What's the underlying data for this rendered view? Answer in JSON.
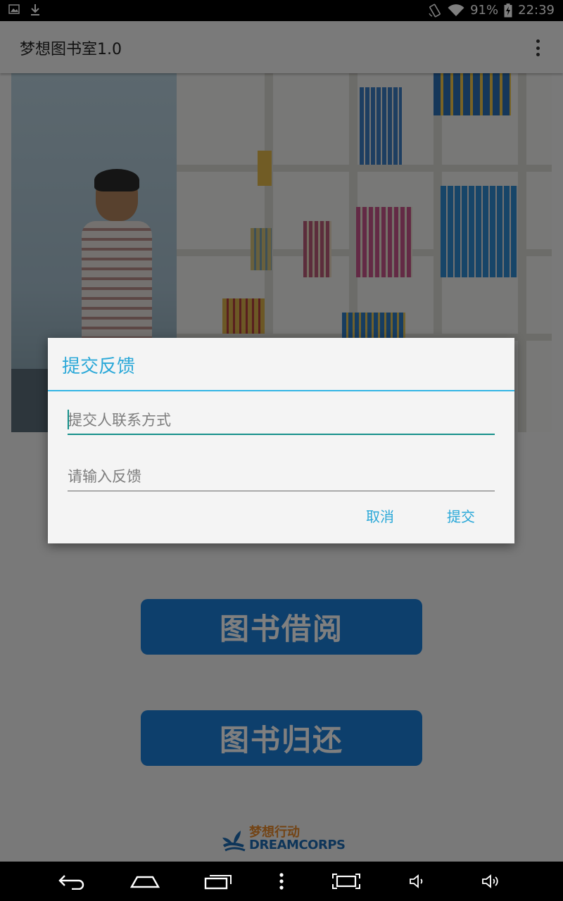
{
  "status_bar": {
    "battery": "91%",
    "time": "22:39",
    "icons": [
      "image-icon",
      "download-icon",
      "rotate-icon",
      "wifi-icon",
      "battery-charging-icon"
    ]
  },
  "action_bar": {
    "title": "梦想图书室1.0",
    "overflow_icon": "more-vert-icon"
  },
  "main": {
    "borrow_label": "图书借阅",
    "return_label": "图书归还",
    "logo_cn": "梦想行动",
    "logo_en": "DREAMCORPS",
    "button_color": "#1b7fd9"
  },
  "dialog": {
    "title": "提交反馈",
    "contact_placeholder": "提交人联系方式",
    "contact_value": "",
    "feedback_placeholder": "请输入反馈",
    "feedback_value": "",
    "cancel_label": "取消",
    "submit_label": "提交",
    "accent_color": "#33b5e5"
  },
  "nav_bar": {
    "icons": [
      "back-icon",
      "home-icon",
      "recent-apps-icon",
      "menu-dots-icon",
      "screenshot-icon",
      "volume-down-icon",
      "volume-up-icon"
    ]
  }
}
